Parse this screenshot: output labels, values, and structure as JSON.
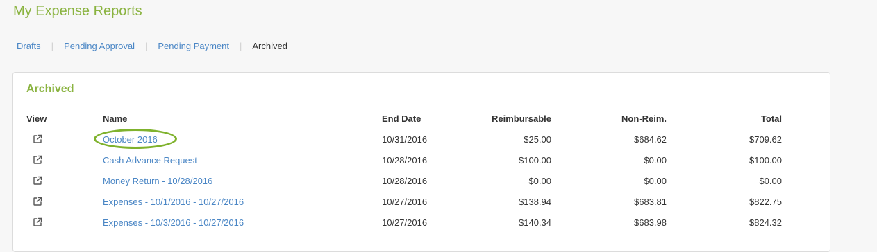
{
  "page": {
    "title": "My Expense Reports"
  },
  "subnav": [
    {
      "label": "Drafts",
      "active": false
    },
    {
      "label": "Pending Approval",
      "active": false
    },
    {
      "label": "Pending Payment",
      "active": false
    },
    {
      "label": "Archived",
      "active": true
    }
  ],
  "panel": {
    "title": "Archived",
    "columns": {
      "view": "View",
      "name": "Name",
      "end_date": "End Date",
      "reimbursable": "Reimbursable",
      "non_reim": "Non-Reim.",
      "total": "Total"
    },
    "rows": [
      {
        "name": "October 2016",
        "end_date": "10/31/2016",
        "reimbursable": "$25.00",
        "non_reim": "$684.62",
        "total": "$709.62",
        "view_icon": "external-link-icon",
        "highlighted": true
      },
      {
        "name": "Cash Advance Request",
        "end_date": "10/28/2016",
        "reimbursable": "$100.00",
        "non_reim": "$0.00",
        "total": "$100.00",
        "view_icon": "external-link-icon"
      },
      {
        "name": "Money Return - 10/28/2016",
        "end_date": "10/28/2016",
        "reimbursable": "$0.00",
        "non_reim": "$0.00",
        "total": "$0.00",
        "view_icon": "external-link-icon"
      },
      {
        "name": "Expenses - 10/1/2016 - 10/27/2016",
        "end_date": "10/27/2016",
        "reimbursable": "$138.94",
        "non_reim": "$683.81",
        "total": "$822.75",
        "view_icon": "external-link-icon"
      },
      {
        "name": "Expenses - 10/3/2016 - 10/27/2016",
        "end_date": "10/27/2016",
        "reimbursable": "$140.34",
        "non_reim": "$683.98",
        "total": "$824.32",
        "view_icon": "external-link-icon"
      }
    ]
  },
  "colors": {
    "accent_green": "#8ab340",
    "link_blue": "#4a86c5",
    "highlight_ring": "#7fb22d"
  }
}
